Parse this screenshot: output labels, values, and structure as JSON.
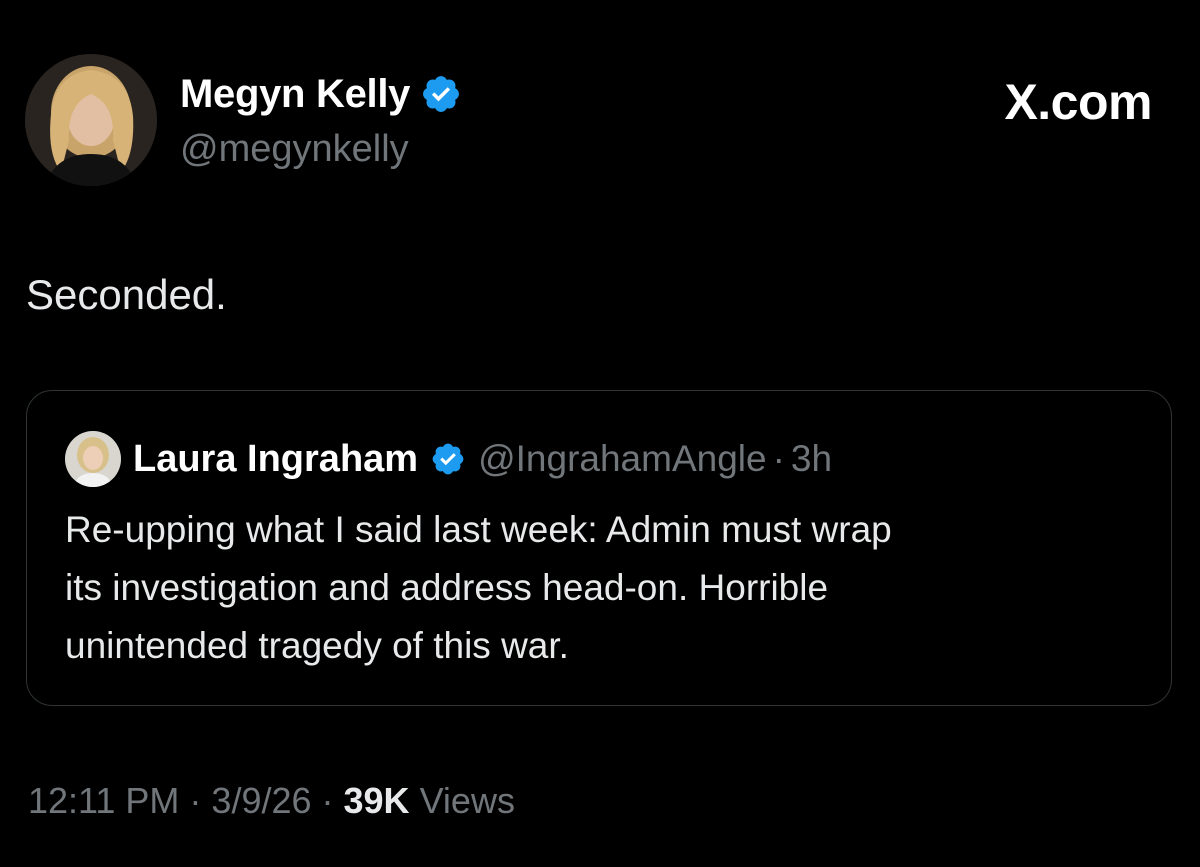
{
  "brand": {
    "label": "X.com"
  },
  "author": {
    "name": "Megyn Kelly",
    "handle": "@megynkelly",
    "verified": true
  },
  "tweet": {
    "text": "Seconded."
  },
  "quoted_tweet": {
    "author_name": "Laura Ingraham",
    "author_handle": "@IngrahamAngle",
    "separator": "·",
    "time_ago": "3h",
    "verified": true,
    "text_lines": [
      "Re-upping what I said last week:  Admin must wrap",
      "its investigation and address head-on.  Horrible",
      "unintended tragedy of this war."
    ]
  },
  "footer": {
    "time": "12:11 PM",
    "sep1": "·",
    "date": "3/9/26",
    "sep2": "·",
    "views_count": "39K",
    "views_label": "Views"
  },
  "colors": {
    "background": "#000000",
    "text_primary": "#e7e9ea",
    "text_secondary": "#71767b",
    "border": "#2f3336",
    "verified_blue": "#1d9bf0"
  },
  "icons": {
    "verified": "verified-badge-icon"
  }
}
